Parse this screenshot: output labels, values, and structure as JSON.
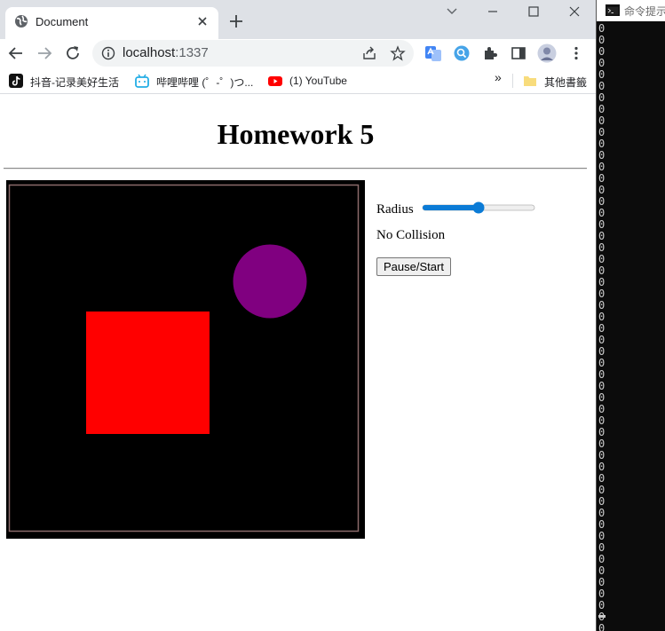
{
  "browser": {
    "tab": {
      "title": "Document"
    },
    "address": {
      "host": "localhost",
      "port": ":1337"
    },
    "bookmarks": [
      {
        "label": "抖音-记录美好生活",
        "icon": "tiktok-icon"
      },
      {
        "label": "哔哩哔哩 (゜-゜)つ...",
        "icon": "bilibili-icon"
      },
      {
        "label": "(1) YouTube",
        "icon": "youtube-icon"
      }
    ],
    "other_bookmarks": "其他書籤",
    "overflow": "»"
  },
  "page": {
    "title": "Homework 5",
    "controls": {
      "radius_label": "Radius",
      "radius_value": 0.5,
      "collision_status": "No Collision",
      "pause_button": "Pause/Start"
    },
    "scene": {
      "background": "#000000",
      "border_color": "#8b6b6b",
      "square_color": "#ff0000",
      "circle_color": "#800080"
    }
  },
  "console": {
    "title": "命令提示",
    "lines": [
      "0",
      "0",
      "0",
      "0",
      "0",
      "0",
      "0",
      "0",
      "0",
      "0",
      "0",
      "0",
      "0",
      "0",
      "0",
      "0",
      "0",
      "0",
      "0",
      "0",
      "0",
      "0",
      "0",
      "0",
      "0",
      "0",
      "0",
      "0",
      "0",
      "0",
      "0",
      "0",
      "0",
      "0",
      "0",
      "0",
      "0",
      "0",
      "0",
      "0",
      "0",
      "0",
      "0",
      "0",
      "0",
      "0",
      "0",
      "0",
      "0",
      "0",
      "0",
      "0",
      "0"
    ]
  },
  "colors": {
    "accent": "#0b7bd6",
    "tabstrip": "#dee1e6",
    "youtube": "#ff0000",
    "bilibili": "#23ade5"
  }
}
